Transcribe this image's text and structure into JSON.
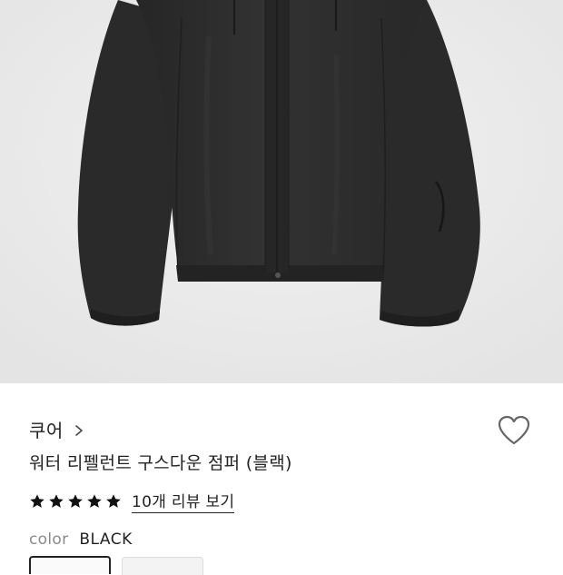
{
  "product": {
    "brand": "쿠어",
    "name": "워터 리펠런트 구스다운 점퍼 (블랙)",
    "rating_stars": 5,
    "review_link": "10개 리뷰 보기",
    "color_label": "color",
    "color_value": "BLACK"
  },
  "icons": {
    "brand_chevron": "chevron-right-icon",
    "wishlist": "heart-outline-icon",
    "star": "star-filled-icon"
  },
  "colors": {
    "jacket": "#2b2b2b",
    "background": "#ececec",
    "text": "#222222",
    "muted": "#8a8a8a"
  }
}
